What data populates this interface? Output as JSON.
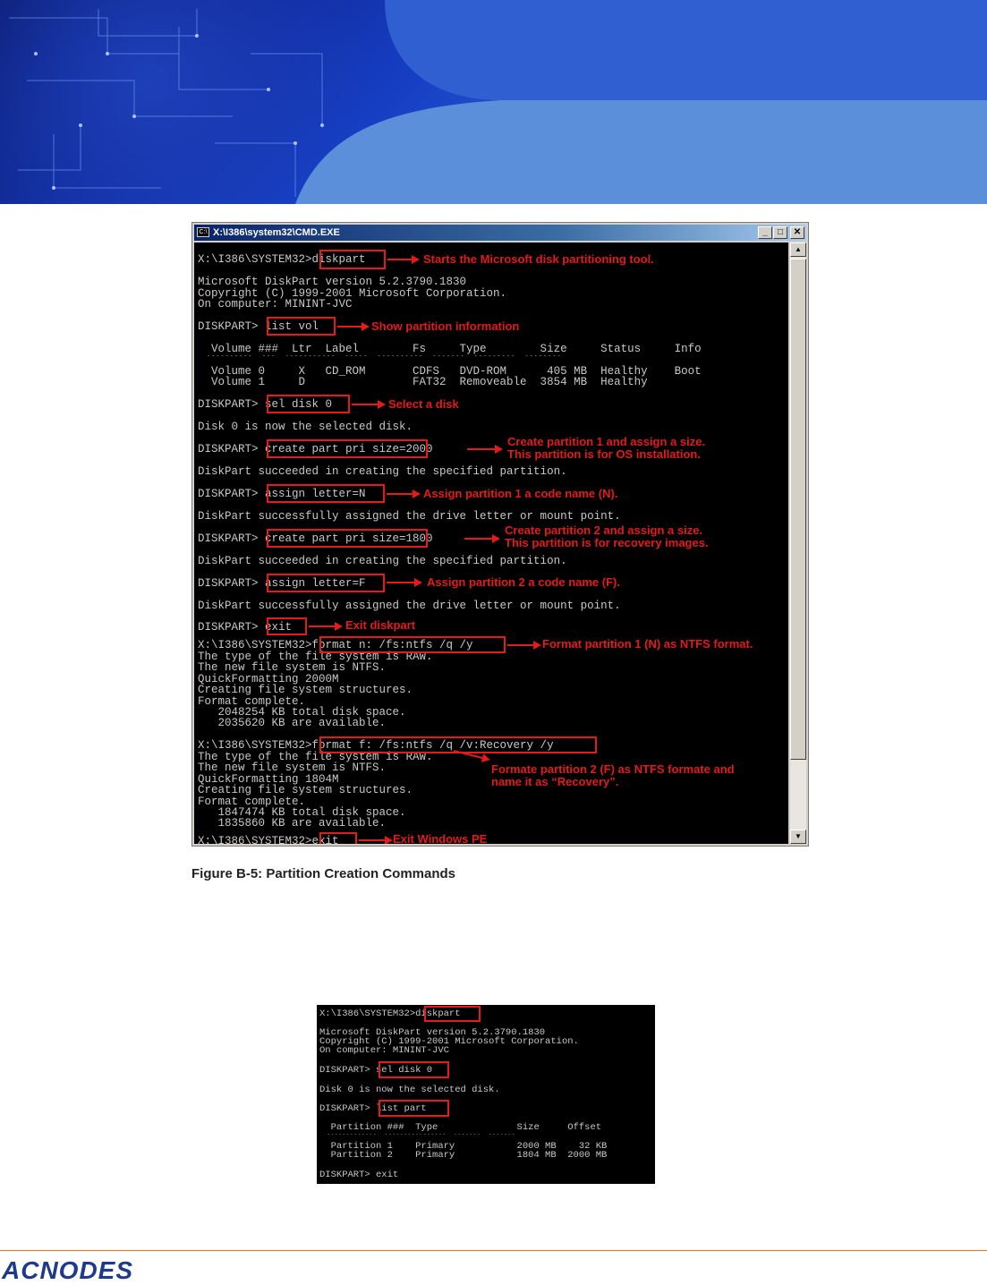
{
  "window": {
    "title": "X:\\I386\\system32\\CMD.EXE",
    "icon": "console-icon",
    "controls": {
      "minimize": "_",
      "restore": "□",
      "close": "✕"
    }
  },
  "console_lines": [
    "X:\\I386\\SYSTEM32>diskpart",
    "Microsoft DiskPart version 5.2.3790.1830",
    "Copyright (C) 1999-2001 Microsoft Corporation.",
    "On computer: MININT-JVC",
    "DISKPART> list vol",
    "  Volume ###  Ltr  Label        Fs     Type        Size     Status     Info",
    "  ----------  ---  -----------  -----  ----------  -------  ---------  --------",
    "  Volume 0     X   CD_ROM       CDFS   DVD-ROM      405 MB  Healthy    Boot",
    "  Volume 1     D                FAT32  Removeable  3854 MB  Healthy",
    "DISKPART> sel disk 0",
    "Disk 0 is now the selected disk.",
    "DISKPART> create part pri size=2000",
    "DiskPart succeeded in creating the specified partition.",
    "DISKPART> assign letter=N",
    "DiskPart successfully assigned the drive letter or mount point.",
    "DISKPART> create part pri size=1800",
    "DiskPart succeeded in creating the specified partition.",
    "DISKPART> assign letter=F",
    "DiskPart successfully assigned the drive letter or mount point.",
    "DISKPART> exit",
    "X:\\I386\\SYSTEM32>format n: /fs:ntfs /q /y",
    "The type of the file system is RAW.",
    "The new file system is NTFS.",
    "QuickFormatting 2000M",
    "Creating file system structures.",
    "Format complete.",
    "   2048254 KB total disk space.",
    "   2035620 KB are available.",
    "X:\\I386\\SYSTEM32>format f: /fs:ntfs /q /v:Recovery /y",
    "The type of the file system is RAW.",
    "The new file system is NTFS.",
    "QuickFormatting 1804M",
    "Creating file system structures.",
    "Format complete.",
    "   1847474 KB total disk space.",
    "   1835860 KB are available.",
    "X:\\I386\\SYSTEM32>exit"
  ],
  "annotations": [
    "Starts the Microsoft disk partitioning tool.",
    "Show partition information",
    "Select a disk",
    "Create partition 1 and assign a size.",
    "This partition is for OS installation.",
    "Assign partition 1 a code name (N).",
    "Create partition 2 and assign a size.",
    "This partition is for recovery images.",
    "Assign partition 2 a code name (F).",
    "Exit diskpart",
    "Format partition 1 (N) as NTFS format.",
    "Formate partition 2 (F) as NTFS formate and",
    "name it as “Recovery”.",
    "Exit Windows PE"
  ],
  "figure_caption": "Figure B-5: Partition Creation Commands",
  "second_screenshot_lines": [
    "X:\\I386\\SYSTEM32>diskpart",
    "Microsoft DiskPart version 5.2.3790.1830",
    "Copyright (C) 1999-2001 Microsoft Corporation.",
    "On computer: MININT-JVC",
    "DISKPART> sel disk 0",
    "Disk 0 is now the selected disk.",
    "DISKPART> list part",
    "  Partition ###  Type              Size     Offset",
    "  -------------  ----------------  -------  -------",
    "  Partition 1    Primary           2000 MB    32 KB",
    "  Partition 2    Primary           1804 MB  2000 MB",
    "DISKPART> exit"
  ],
  "footer": {
    "logo": "ACNODES"
  },
  "colors": {
    "annotation": "#e21b1b",
    "console_bg": "#000000",
    "console_text": "#c8c8c8",
    "footer_rule": "#e8711e",
    "logo": "#1f3a8a"
  }
}
